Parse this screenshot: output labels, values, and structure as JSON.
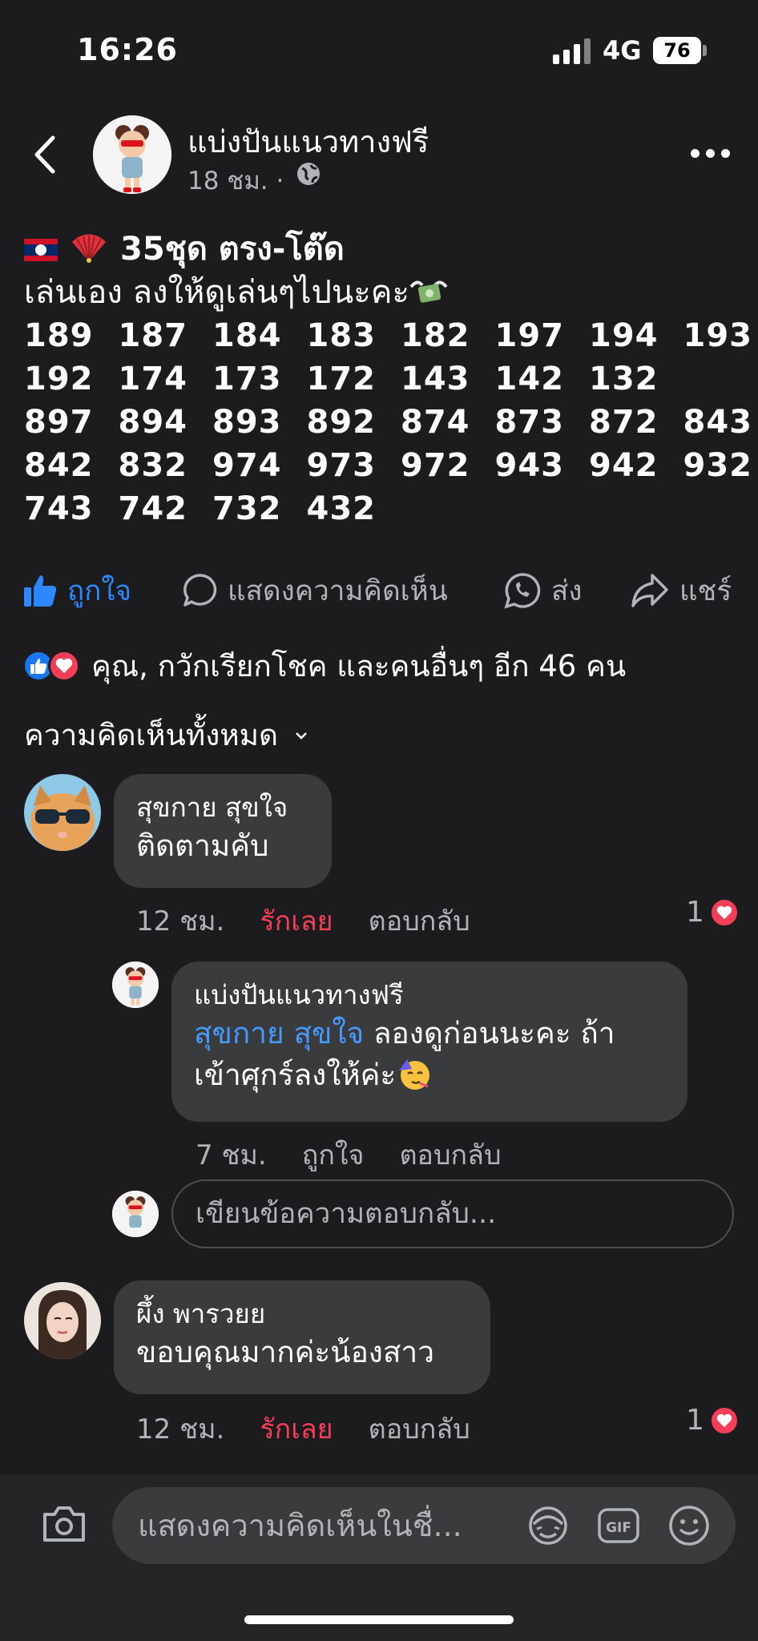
{
  "status_bar": {
    "time": "16:26",
    "network": "4G",
    "battery": "76"
  },
  "post": {
    "page_name": "แบ่งปันแนวทางฟรี",
    "meta": "18 ชม. ·",
    "title": "35ชุด ตรง-โต๊ด",
    "subtitle": "เล่นเอง ลงให้ดูเล่นๆไปนะคะ",
    "number_rows": [
      [
        "189",
        "187",
        "184",
        "183",
        "182",
        "197",
        "194",
        "193"
      ],
      [
        "192",
        "174",
        "173",
        "172",
        "143",
        "142",
        "132"
      ],
      [
        "897",
        "894",
        "893",
        "892",
        "874",
        "873",
        "872",
        "843"
      ],
      [
        "842",
        "832",
        "974",
        "973",
        "972",
        "943",
        "942",
        "932"
      ],
      [
        "743",
        "742",
        "732",
        "432"
      ]
    ]
  },
  "actions": {
    "like": "ถูกใจ",
    "comment": "แสดงความคิดเห็น",
    "send": "ส่ง",
    "share": "แชร์"
  },
  "reactions_summary": "คุณ, กวักเรียกโชค และคนอื่นๆ อีก 46 คน",
  "comments_filter": "ความคิดเห็นทั้งหมด",
  "comments": [
    {
      "name": "สุขกาย  สุขใจ",
      "text": "ติดตามคับ",
      "time": "12 ชม.",
      "reaction_label": "รักเลย",
      "reply_label": "ตอบกลับ",
      "reaction_count": "1"
    },
    {
      "name": "แบ่งปันแนวทางฟรี",
      "mention": "สุขกาย  สุขใจ",
      "text_line1": " ลองดูก่อนนะคะ ถ้า",
      "text_line2": "เข้าศุกร์ลงให้ค่ะ",
      "time": "7 ชม.",
      "reaction_label": "ถูกใจ",
      "reply_label": "ตอบกลับ"
    },
    {
      "name": "ผึ้ง พารวยย",
      "text": "ขอบคุณมากค่ะน้องสาว",
      "time": "12 ชม.",
      "reaction_label": "รักเลย",
      "reply_label": "ตอบกลับ",
      "reaction_count": "1"
    }
  ],
  "reply_placeholder": "เขียนข้อความตอบกลับ...",
  "composer_placeholder": "แสดงความคิดเห็นในชื่...",
  "composer_icons": [
    "camera-icon",
    "avatar-sticker-icon",
    "gif-icon",
    "emoji-icon"
  ],
  "colors": {
    "background": "#1c1c1e",
    "bubble": "#3a3b3c",
    "link_blue": "#2d88ff",
    "love_red": "#f33e58"
  }
}
